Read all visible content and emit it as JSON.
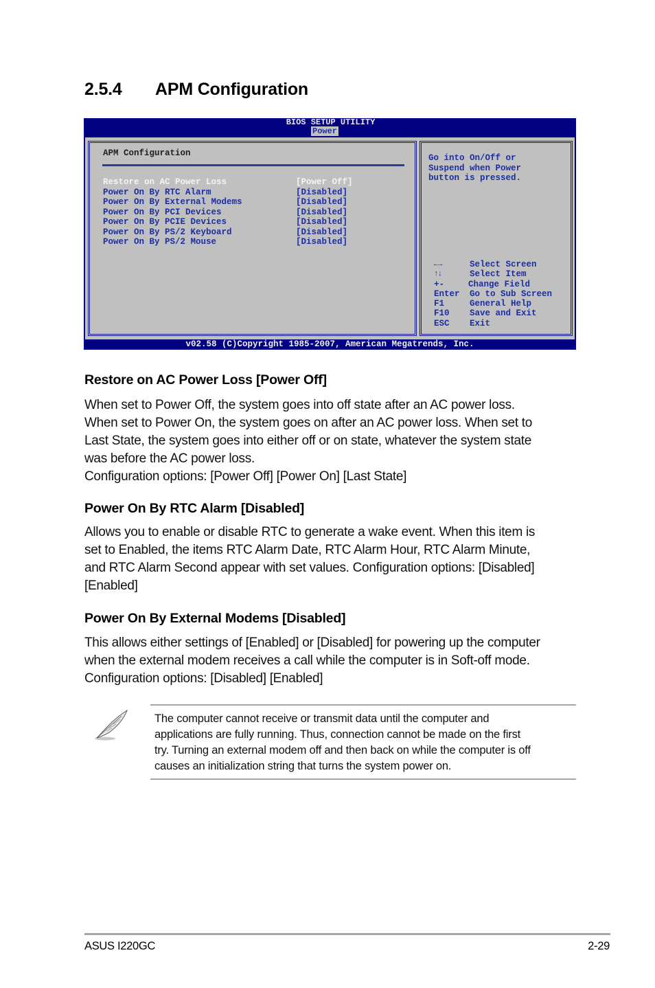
{
  "section": {
    "number": "2.5.4",
    "title": "APM Configuration"
  },
  "bios": {
    "title": "BIOS SETUP UTILITY",
    "active_tab": "Power",
    "panel_heading": "APM Configuration",
    "settings": [
      {
        "label": "Restore on AC Power Loss",
        "value": "[Power Off]",
        "selected": true
      },
      {
        "label": "Power On By RTC Alarm",
        "value": "[Disabled]",
        "selected": false
      },
      {
        "label": "Power On By External Modems",
        "value": "[Disabled]",
        "selected": false
      },
      {
        "label": "Power On By PCI Devices",
        "value": "[Disabled]",
        "selected": false
      },
      {
        "label": "Power On By PCIE Devices",
        "value": "[Disabled]",
        "selected": false
      },
      {
        "label": "Power On By PS/2 Keyboard",
        "value": "[Disabled]",
        "selected": false
      },
      {
        "label": "Power On By PS/2 Mouse",
        "value": "[Disabled]",
        "selected": false
      }
    ],
    "help_text": "Go into On/Off or\nSuspend when Power\nbutton is pressed.",
    "keys": [
      {
        "key": "←→",
        "action": "Select Screen",
        "icon": "left-right-arrows-icon"
      },
      {
        "key": "↑↓",
        "action": "Select Item",
        "icon": "up-down-arrows-icon"
      },
      {
        "key": "+-",
        "action": "Change Field"
      },
      {
        "key": "Enter",
        "action": "Go to Sub Screen"
      },
      {
        "key": "F1",
        "action": "General Help"
      },
      {
        "key": "F10",
        "action": "Save and Exit"
      },
      {
        "key": "ESC",
        "action": "Exit"
      }
    ],
    "footer": "v02.58 (C)Copyright 1985-2007, American Megatrends, Inc.",
    "colors": {
      "frame": "#000080",
      "panel": "#c0c0c0",
      "text": "#1c2ea0",
      "highlight": "#f4f4f4"
    }
  },
  "items": [
    {
      "heading": "Restore on AC Power Loss [Power Off]",
      "body": [
        "When set to Power Off, the system goes into off state after an AC power loss.",
        "When set to Power On, the system goes on after an AC power loss. When set to",
        "Last State, the system goes into either off or on state, whatever the system state",
        "was before the AC power loss.",
        "Configuration options: [Power Off] [Power On] [Last State]"
      ]
    },
    {
      "heading": "Power On By RTC Alarm [Disabled]",
      "body": [
        "Allows you to enable or disable RTC to generate a wake event. When this item is",
        "set to Enabled, the items RTC Alarm Date, RTC Alarm Hour, RTC Alarm Minute,",
        "and RTC Alarm Second appear with set values. Configuration options: [Disabled]",
        "[Enabled]"
      ]
    },
    {
      "heading": "Power On By External Modems [Disabled]",
      "body": [
        "This allows either settings of [Enabled] or [Disabled] for powering up the computer",
        "when the external modem receives a call while the computer is in Soft-off mode.",
        "Configuration options: [Disabled] [Enabled]"
      ]
    }
  ],
  "note": {
    "icon": "feather-pen-icon",
    "lines": [
      "The computer cannot receive or transmit data until the computer and",
      "applications are fully running. Thus, connection cannot be made on the first",
      "try. Turning an external modem off and then back on while the computer is off",
      "causes an initialization string that turns the system power on."
    ]
  },
  "footer": {
    "product": "ASUS I220GC",
    "page": "2-29"
  }
}
